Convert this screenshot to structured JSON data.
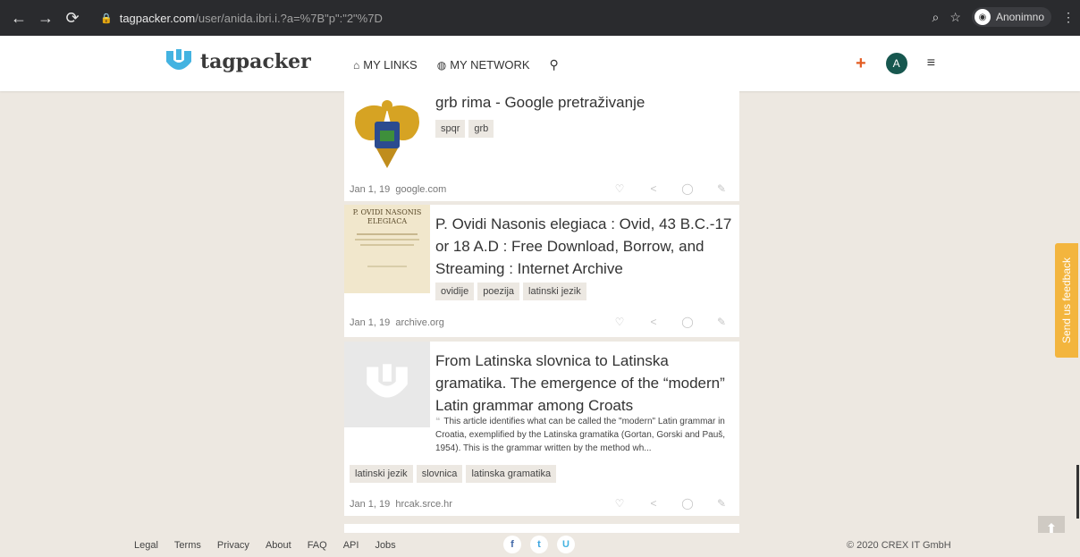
{
  "browser": {
    "url_host": "tagpacker.com",
    "url_path": "/user/anida.ibri.i.?a=%7B\"p\":\"2\"%7D",
    "profile_name": "Anonimno",
    "nav_icons": [
      "back-icon",
      "forward-icon",
      "reload-icon"
    ]
  },
  "header": {
    "logo_text": "tagpacker",
    "nav": [
      {
        "label": "MY LINKS",
        "icon": "home-icon"
      },
      {
        "label": "MY NETWORK",
        "icon": "globe-icon"
      }
    ],
    "avatar_letter": "A",
    "accent_color": "#43b3e1",
    "add_color": "#e35d23"
  },
  "cards": [
    {
      "title": "grb rima - Google pretraživanje",
      "tags": [
        "spqr",
        "grb"
      ],
      "date": "Jan 1, 19",
      "domain": "google.com"
    },
    {
      "title": "P. Ovidi Nasonis elegiaca : Ovid, 43 B.C.-17 or 18 A.D : Free Download, Borrow, and Streaming : Internet Archive",
      "thumb_lines": [
        "P. OVIDI NASONIS",
        "ELEGIACA"
      ],
      "tags": [
        "ovidije",
        "poezija",
        "latinski jezik"
      ],
      "date": "Jan 1, 19",
      "domain": "archive.org"
    },
    {
      "title": "From Latinska slovnica to Latinska gramatika. The emergence of the “modern” Latin grammar among Croats",
      "excerpt": "This article identifies what can be called the \"modern\" Latin grammar in Croatia, exemplified by the Latinska gramatika (Gortan, Gorski and Pauš, 1954). This is the grammar written by the method wh...",
      "tags": [
        "latinski jezik",
        "slovnica",
        "latinska gramatika"
      ],
      "date": "Jan 1, 19",
      "domain": "hrcak.srce.hr"
    }
  ],
  "feedback_label": "Send us feedback",
  "footer": {
    "links": [
      "Legal",
      "Terms",
      "Privacy",
      "About",
      "FAQ",
      "API",
      "Jobs"
    ],
    "socials": [
      "facebook-icon",
      "twitter-icon",
      "tagpacker-icon"
    ],
    "copyright": "© 2020 CREX IT GmbH"
  }
}
